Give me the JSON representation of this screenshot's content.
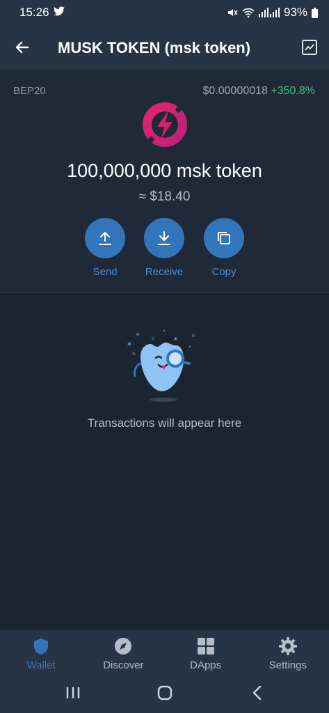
{
  "status_bar": {
    "time": "15:26",
    "battery": "93%"
  },
  "app_bar": {
    "title": "MUSK TOKEN (msk token)"
  },
  "token": {
    "network": "BEP20",
    "price": "$0.00000018",
    "change": "+350.8%",
    "balance": "100,000,000 msk token",
    "fiat": "≈ $18.40",
    "logo_color": "#e5256f"
  },
  "actions": [
    {
      "label": "Send",
      "icon": "upload-icon"
    },
    {
      "label": "Receive",
      "icon": "download-icon"
    },
    {
      "label": "Copy",
      "icon": "copy-icon"
    }
  ],
  "empty_state": {
    "text": "Transactions will appear here"
  },
  "bottom_nav": [
    {
      "label": "Wallet",
      "icon": "shield-icon",
      "active": true
    },
    {
      "label": "Discover",
      "icon": "compass-icon",
      "active": false
    },
    {
      "label": "DApps",
      "icon": "grid-icon",
      "active": false
    },
    {
      "label": "Settings",
      "icon": "gear-icon",
      "active": false
    }
  ],
  "colors": {
    "accent": "#3375bb",
    "positive": "#45c08a",
    "background": "#1b2431"
  }
}
